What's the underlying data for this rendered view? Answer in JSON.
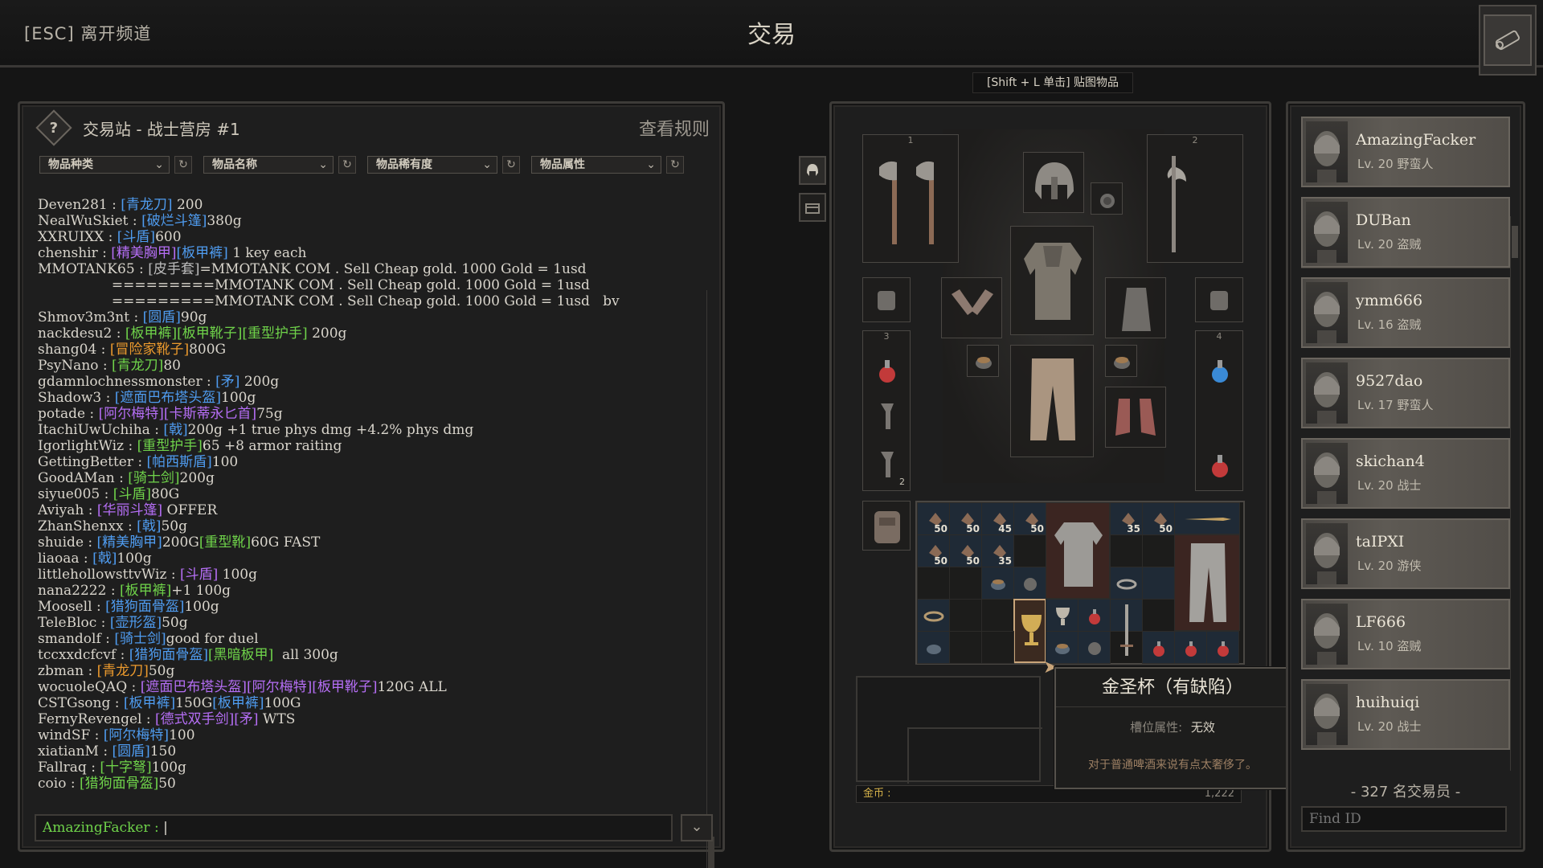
{
  "header": {
    "esc_leave": "[ESC] 离开频道",
    "title": "交易",
    "paste_hint": "[Shift + L 单击] 贴图物品"
  },
  "chat": {
    "title": "交易站 - 战士营房 #1",
    "rules": "查看规则",
    "filters": [
      "物品种类",
      "物品名称",
      "物品稀有度",
      "物品属性"
    ],
    "input_name": "AmazingFacker :",
    "lines": [
      [
        [
          "t",
          "Deven281 : "
        ],
        [
          "blue",
          "[青龙刀]"
        ],
        [
          "t",
          " 200"
        ]
      ],
      [
        [
          "t",
          "NealWuSkiet : "
        ],
        [
          "blue",
          "[破烂斗篷]"
        ],
        [
          "t",
          "380g"
        ]
      ],
      [
        [
          "t",
          "XXRUIXX : "
        ],
        [
          "blue",
          "[斗盾]"
        ],
        [
          "t",
          "600"
        ]
      ],
      [
        [
          "t",
          "chenshir : "
        ],
        [
          "purple",
          "[精美胸甲]"
        ],
        [
          "blue",
          "[板甲裤]"
        ],
        [
          "t",
          " 1 key each"
        ]
      ],
      [
        [
          "t",
          "MMOTANK65 : "
        ],
        [
          "gray",
          "[皮手套]"
        ],
        [
          "t",
          "=MMOTANK COM . Sell Cheap gold. 1000 Gold = 1usd"
        ]
      ],
      [
        [
          "t",
          "                 =========MMOTANK COM . Sell Cheap gold. 1000 Gold = 1usd"
        ]
      ],
      [
        [
          "t",
          "                 =========MMOTANK COM . Sell Cheap gold. 1000 Gold = 1usd   bv"
        ]
      ],
      [
        [
          "t",
          "Shmov3m3nt : "
        ],
        [
          "blue",
          "[圆盾]"
        ],
        [
          "t",
          "90g"
        ]
      ],
      [
        [
          "t",
          "nackdesu2 : "
        ],
        [
          "green",
          "[板甲裤][板甲靴子][重型护手]"
        ],
        [
          "t",
          " 200g"
        ]
      ],
      [
        [
          "t",
          "shang04 : "
        ],
        [
          "orange",
          "[冒险家靴子]"
        ],
        [
          "t",
          "800G"
        ]
      ],
      [
        [
          "t",
          "PsyNano : "
        ],
        [
          "green",
          "[青龙刀]"
        ],
        [
          "t",
          "80"
        ]
      ],
      [
        [
          "t",
          "gdamnlochnessmonster : "
        ],
        [
          "blue",
          "[矛]"
        ],
        [
          "t",
          " 200g"
        ]
      ],
      [
        [
          "t",
          "Shadow3 : "
        ],
        [
          "blue",
          "[遮面巴布塔头盔]"
        ],
        [
          "t",
          "100g"
        ]
      ],
      [
        [
          "t",
          "potade : "
        ],
        [
          "purple",
          "[阿尔梅特][卡斯蒂永匕首]"
        ],
        [
          "t",
          "75g"
        ]
      ],
      [
        [
          "t",
          "ItachiUwUchiha : "
        ],
        [
          "blue",
          "[戟]"
        ],
        [
          "t",
          "200g +1 true phys dmg +4.2% phys dmg"
        ]
      ],
      [
        [
          "t",
          "IgorlightWiz : "
        ],
        [
          "green",
          "[重型护手]"
        ],
        [
          "t",
          "65 +8 armor raiting"
        ]
      ],
      [
        [
          "t",
          "GettingBetter : "
        ],
        [
          "blue",
          "[帕西斯盾]"
        ],
        [
          "t",
          "100"
        ]
      ],
      [
        [
          "t",
          "GoodAMan : "
        ],
        [
          "green",
          "[骑士剑]"
        ],
        [
          "t",
          "200g"
        ]
      ],
      [
        [
          "t",
          "siyue005 : "
        ],
        [
          "green",
          "[斗盾]"
        ],
        [
          "t",
          "80G"
        ]
      ],
      [
        [
          "t",
          "Aviyah : "
        ],
        [
          "purple",
          "[华丽斗篷]"
        ],
        [
          "t",
          " OFFER"
        ]
      ],
      [
        [
          "t",
          "ZhanShenxx : "
        ],
        [
          "blue",
          "[戟]"
        ],
        [
          "t",
          "50g"
        ]
      ],
      [
        [
          "t",
          "shuide : "
        ],
        [
          "blue",
          "[精美胸甲]"
        ],
        [
          "t",
          "200G"
        ],
        [
          "green",
          "[重型靴]"
        ],
        [
          "t",
          "60G FAST"
        ]
      ],
      [
        [
          "t",
          "liaoaa : "
        ],
        [
          "blue",
          "[戟]"
        ],
        [
          "t",
          "100g"
        ]
      ],
      [
        [
          "t",
          "littlehollowsttvWiz : "
        ],
        [
          "purple",
          "[斗盾]"
        ],
        [
          "t",
          " 100g"
        ]
      ],
      [
        [
          "t",
          "nana2222 : "
        ],
        [
          "green",
          "[板甲裤]"
        ],
        [
          "t",
          "+1 100g"
        ]
      ],
      [
        [
          "t",
          "Moosell : "
        ],
        [
          "blue",
          "[猎狗面骨盔]"
        ],
        [
          "t",
          "100g"
        ]
      ],
      [
        [
          "t",
          "TeleBloc : "
        ],
        [
          "blue",
          "[壶形盔]"
        ],
        [
          "t",
          "50g"
        ]
      ],
      [
        [
          "t",
          "smandolf : "
        ],
        [
          "blue",
          "[骑士剑]"
        ],
        [
          "t",
          "good for duel"
        ]
      ],
      [
        [
          "t",
          "tccxxdcfcvf : "
        ],
        [
          "blue",
          "[猎狗面骨盔]"
        ],
        [
          "green",
          "[黑暗板甲]"
        ],
        [
          "t",
          "  all 300g"
        ]
      ],
      [
        [
          "t",
          "zbman : "
        ],
        [
          "orange",
          "[青龙刀]"
        ],
        [
          "t",
          "50g"
        ]
      ],
      [
        [
          "t",
          "wocuoleQAQ : "
        ],
        [
          "purple",
          "[遮面巴布塔头盔][阿尔梅特][板甲靴子]"
        ],
        [
          "t",
          "120G ALL"
        ]
      ],
      [
        [
          "t",
          "CSTGsong : "
        ],
        [
          "blue",
          "[板甲裤]"
        ],
        [
          "t",
          "150G"
        ],
        [
          "blue",
          "[板甲裤]"
        ],
        [
          "t",
          "100G"
        ]
      ],
      [
        [
          "t",
          "FernyRevengel : "
        ],
        [
          "purple",
          "[德式双手剑][矛]"
        ],
        [
          "t",
          " WTS"
        ]
      ],
      [
        [
          "t",
          "windSF : "
        ],
        [
          "blue",
          "[阿尔梅特]"
        ],
        [
          "t",
          "100"
        ]
      ],
      [
        [
          "t",
          "xiatianM : "
        ],
        [
          "blue",
          "[圆盾]"
        ],
        [
          "t",
          "150"
        ]
      ],
      [
        [
          "t",
          "Fallraq : "
        ],
        [
          "green",
          "[十字弩]"
        ],
        [
          "t",
          "100g"
        ]
      ],
      [
        [
          "t",
          "coio : "
        ],
        [
          "green",
          "[猎狗面骨盔]"
        ],
        [
          "t",
          "50"
        ]
      ]
    ]
  },
  "equipment": {
    "slot_numbers": [
      "1",
      "2",
      "3",
      "4"
    ],
    "quiver_count": "2",
    "gold_label": "金币 :",
    "gold_value": "1,222",
    "inventory_quantities": [
      "50",
      "50",
      "45",
      "50",
      "35",
      "50",
      "50",
      "50",
      "35"
    ]
  },
  "tooltip": {
    "title": "金圣杯（有缺陷）",
    "slot_label": "槽位属性:",
    "slot_value": "无效",
    "description": "对于普通啤酒来说有点太奢侈了。"
  },
  "traders": {
    "list": [
      {
        "name": "AmazingFacker",
        "level": "Lv. 20 野蛮人"
      },
      {
        "name": "DUBan",
        "level": "Lv. 20 盗贼"
      },
      {
        "name": "ymm666",
        "level": "Lv. 16 盗贼"
      },
      {
        "name": "9527dao",
        "level": "Lv. 17 野蛮人"
      },
      {
        "name": "skichan4",
        "level": "Lv. 20 战士"
      },
      {
        "name": "taIPXI",
        "level": "Lv. 20 游侠"
      },
      {
        "name": "LF666",
        "level": "Lv. 10 盗贼"
      },
      {
        "name": "huihuiqi",
        "level": "Lv. 20 战士"
      }
    ],
    "count": "- 327 名交易员 -",
    "find_placeholder": "Find ID"
  },
  "colors": {
    "rarity_blue": "#4f9cf0",
    "rarity_purple": "#b56ef5",
    "rarity_green": "#6fd34a",
    "rarity_orange": "#ec9a2d",
    "gold": "#d6b24a"
  }
}
